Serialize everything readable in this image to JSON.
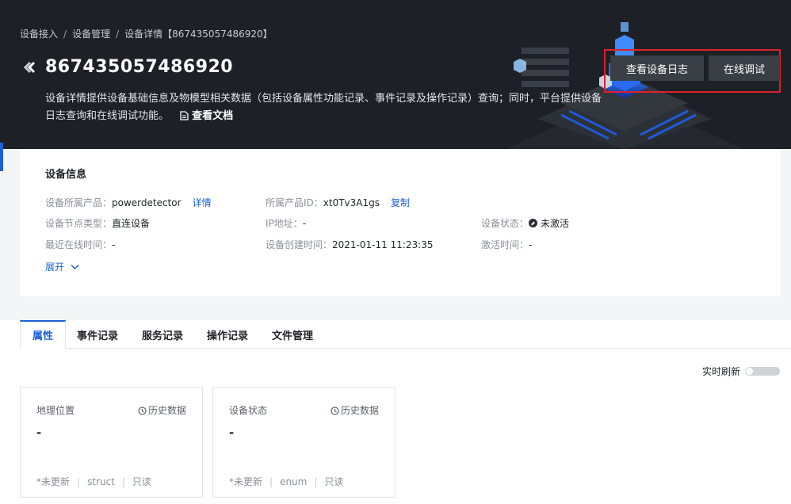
{
  "breadcrumb": [
    "设备接入",
    "设备管理",
    "设备详情【867435057486920】"
  ],
  "title": "867435057486920",
  "description": "设备详情提供设备基础信息及物模型相关数据（包括设备属性功能记录、事件记录及操作记录）查询；同时，平台提供设备日志查询和在线调试功能。",
  "doc_link": "查看文档",
  "header_buttons": {
    "logs": "查看设备日志",
    "debug": "在线调试"
  },
  "info": {
    "title": "设备信息",
    "product_label": "设备所属产品：",
    "product_value": "powerdetector",
    "product_link": "详情",
    "product_id_label": "所属产品ID：",
    "product_id_value": "xt0Tv3A1gs",
    "copy_link": "复制",
    "node_type_label": "设备节点类型：",
    "node_type_value": "直连设备",
    "ip_label": "IP地址：",
    "ip_value": "-",
    "status_label": "设备状态：",
    "status_value": "未激活",
    "last_online_label": "最近在线时间：",
    "last_online_value": "-",
    "created_label": "设备创建时间：",
    "created_value": "2021-01-11 11:23:35",
    "activated_label": "激活时间：",
    "activated_value": "-",
    "expand": "展开"
  },
  "tabs": [
    "属性",
    "事件记录",
    "服务记录",
    "操作记录",
    "文件管理"
  ],
  "active_tab": "属性",
  "realtime_refresh": "实时刷新",
  "properties": [
    {
      "name": "地理位置",
      "history": "历史数据",
      "value": "-",
      "updated": "*未更新",
      "type": "struct",
      "access": "只读"
    },
    {
      "name": "设备状态",
      "history": "历史数据",
      "value": "-",
      "updated": "*未更新",
      "type": "enum",
      "access": "只读"
    }
  ],
  "colors": {
    "accent": "#1b62d6",
    "header_bg": "#1d2026",
    "highlight_border": "#e0202a"
  }
}
